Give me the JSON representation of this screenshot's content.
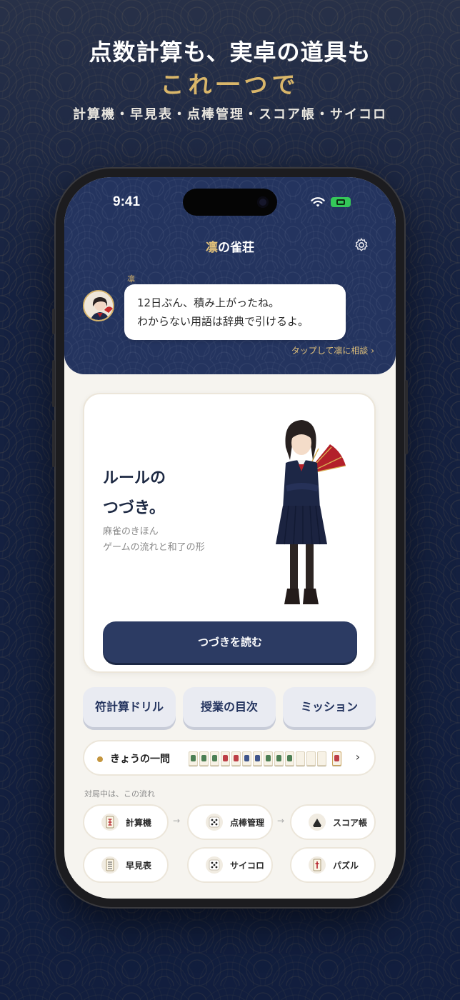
{
  "promo": {
    "line1": "点数計算も、実卓の道具も",
    "line2": "これ一つで",
    "subtitle": "計算機・早見表・点棒管理・スコア帳・サイコロ"
  },
  "status_bar": {
    "time": "9:41"
  },
  "header": {
    "title_accent": "凛",
    "title_rest": "の雀荘",
    "speaker": "凛",
    "message_line1": "12日ぶん、積み上がったね。",
    "message_line2": "わからない用語は辞典で引けるよ。",
    "consult_link": "タップして凛に相談 ›"
  },
  "feature": {
    "title_line1": "ルールの",
    "title_line2": "つづき。",
    "desc_line1": "麻雀のきほん",
    "desc_line2": "ゲームの流れと和了の形",
    "button_label": "つづきを読む"
  },
  "nav": {
    "drill": "符計算ドリル",
    "lessons": "授業の目次",
    "missions": "ミッション"
  },
  "daily": {
    "label": "きょうの一問",
    "tile_count": 14,
    "chevron": "›"
  },
  "flow": {
    "label": "対局中は、この流れ",
    "arrow": "→",
    "tools": [
      {
        "label": "計算機",
        "icon": "tile-calculator-icon"
      },
      {
        "label": "点棒管理",
        "icon": "dice-icon"
      },
      {
        "label": "スコア帳",
        "icon": "score-icon"
      },
      {
        "label": "早見表",
        "icon": "table-icon"
      },
      {
        "label": "サイコロ",
        "icon": "dice-icon"
      },
      {
        "label": "パズル",
        "icon": "puzzle-icon"
      }
    ]
  },
  "colors": {
    "navy": "#24345f",
    "gold": "#d9b66a",
    "card": "#ffffff",
    "screen_bg": "#f6f4ef"
  }
}
